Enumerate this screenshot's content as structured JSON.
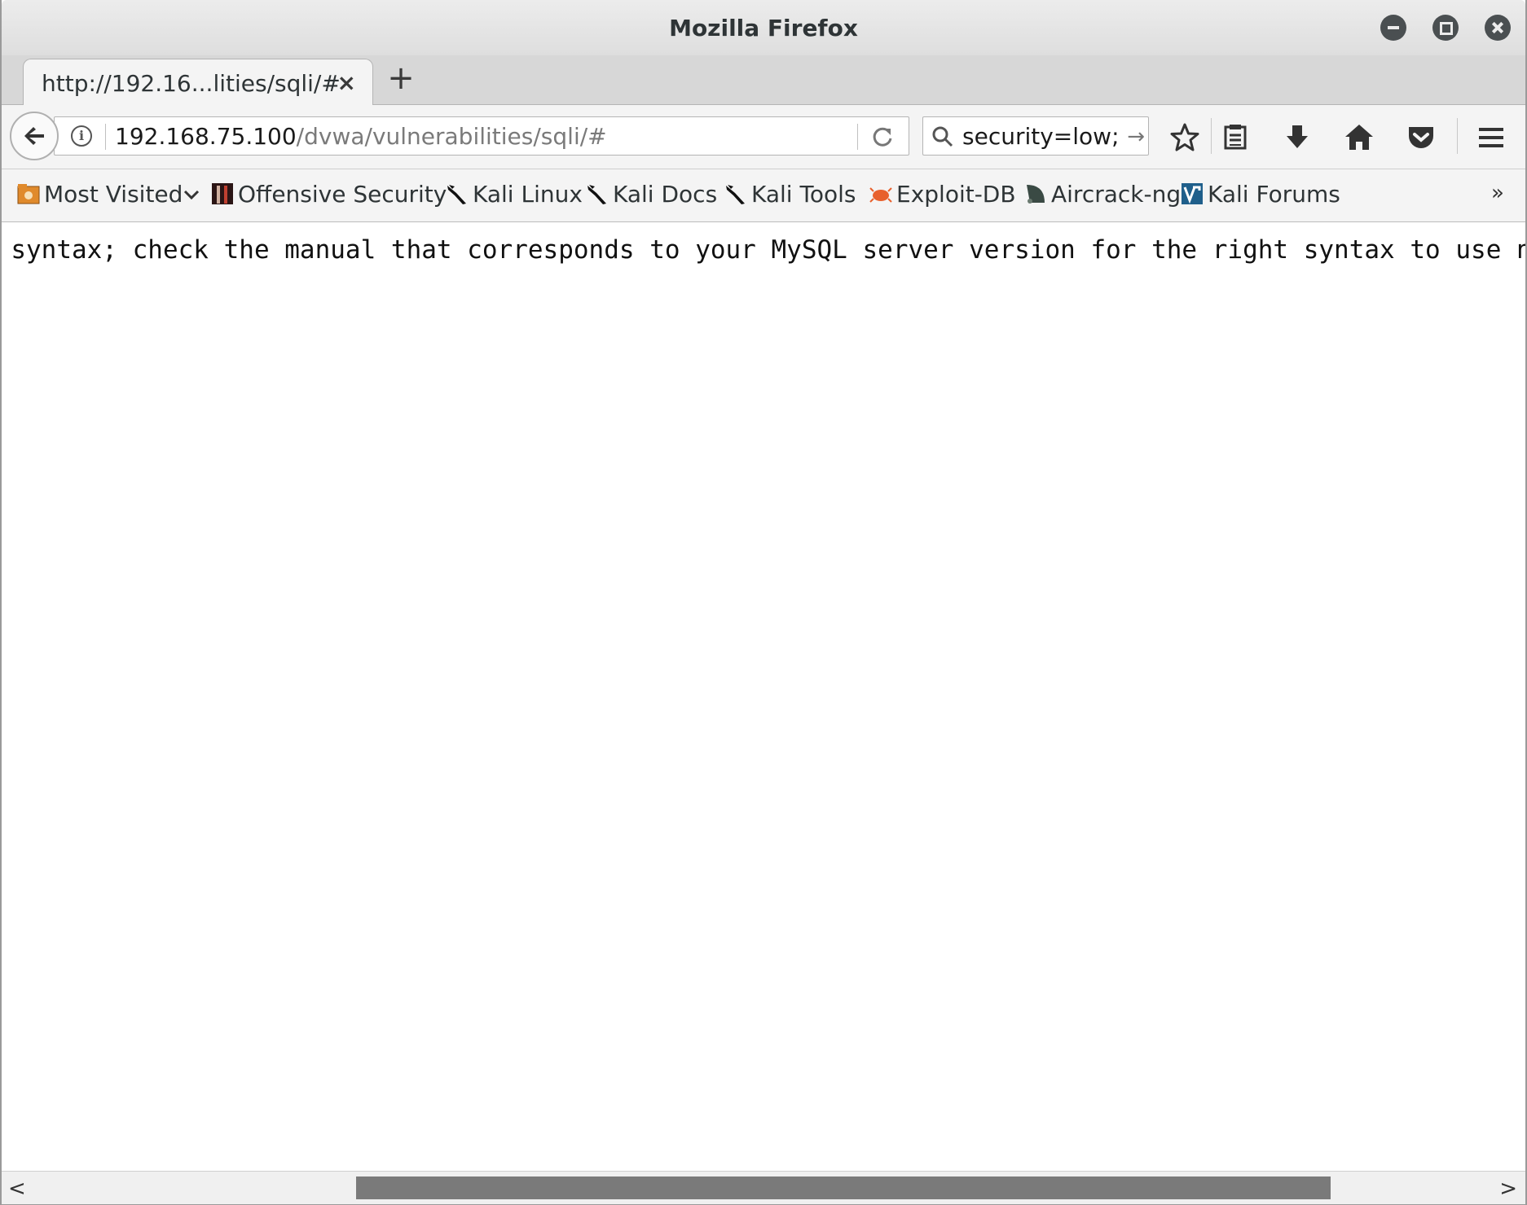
{
  "window": {
    "title": "Mozilla Firefox"
  },
  "tabs": [
    {
      "title": "http://192.16...lities/sqli/#",
      "close_label": "×"
    }
  ],
  "new_tab_label": "+",
  "urlbar": {
    "host": "192.168.75.100",
    "path": "/dvwa/vulnerabilities/sqli/#",
    "info_label": "i"
  },
  "searchbar": {
    "value": "security=low; P",
    "go_label": "→"
  },
  "bookmarks": [
    {
      "label": "Most Visited",
      "icon": "folder-icon"
    },
    {
      "label": "Offensive Security",
      "icon": "offensive-security-icon"
    },
    {
      "label": "Kali Linux",
      "icon": "kali-dragon-icon"
    },
    {
      "label": "Kali Docs",
      "icon": "kali-dragon-icon"
    },
    {
      "label": "Kali Tools",
      "icon": "kali-dragon-icon"
    },
    {
      "label": "Exploit-DB",
      "icon": "exploit-db-icon"
    },
    {
      "label": "Aircrack-ng",
      "icon": "aircrack-icon"
    },
    {
      "label": "Kali Forums",
      "icon": "kali-forums-icon"
    }
  ],
  "bookmarks_overflow": "»",
  "page": {
    "text": "L syntax; check the manual that corresponds to your MySQL server version for the right syntax to use near"
  },
  "scrollbar": {
    "left_arrow": "<",
    "right_arrow": ">"
  }
}
